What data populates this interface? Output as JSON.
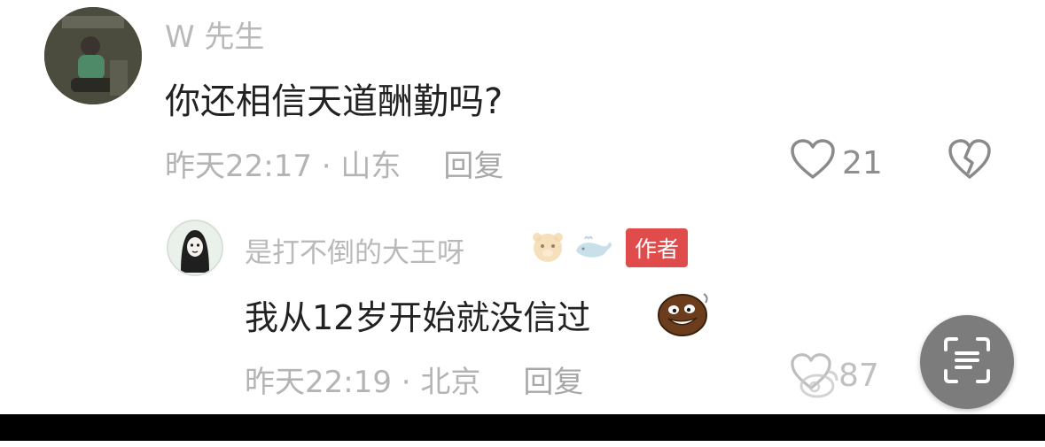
{
  "comments": {
    "main": {
      "username": "W 先生",
      "text": "你还相信天道酬勤吗?",
      "time_location": "昨天22:17 · 山东",
      "reply_label": "回复",
      "like_count": "21",
      "icons": {
        "like": "heart-outline-icon",
        "dislike": "broken-heart-icon"
      }
    },
    "reply": {
      "username": "是打不倒的大王呀",
      "author_badge": "作者",
      "text": "我从12岁开始就没信过",
      "time_location": "昨天22:19 · 北京",
      "reply_label": "回复",
      "like_count": "87",
      "icons": {
        "badge_emoji_1": "tiger-face-icon",
        "badge_emoji_2": "whale-icon",
        "text_emoji": "laughing-face-emoji-icon",
        "like": "heart-outline-icon"
      }
    }
  },
  "overlay": {
    "scan_button_icon": "text-scan-icon",
    "watermark_icon": "weibo-logo-icon"
  },
  "colors": {
    "author_badge": "#e04b4b",
    "primary_text": "#222222",
    "secondary_text": "#b4b4b4",
    "scan_button_bg": "#7c7c7c"
  }
}
